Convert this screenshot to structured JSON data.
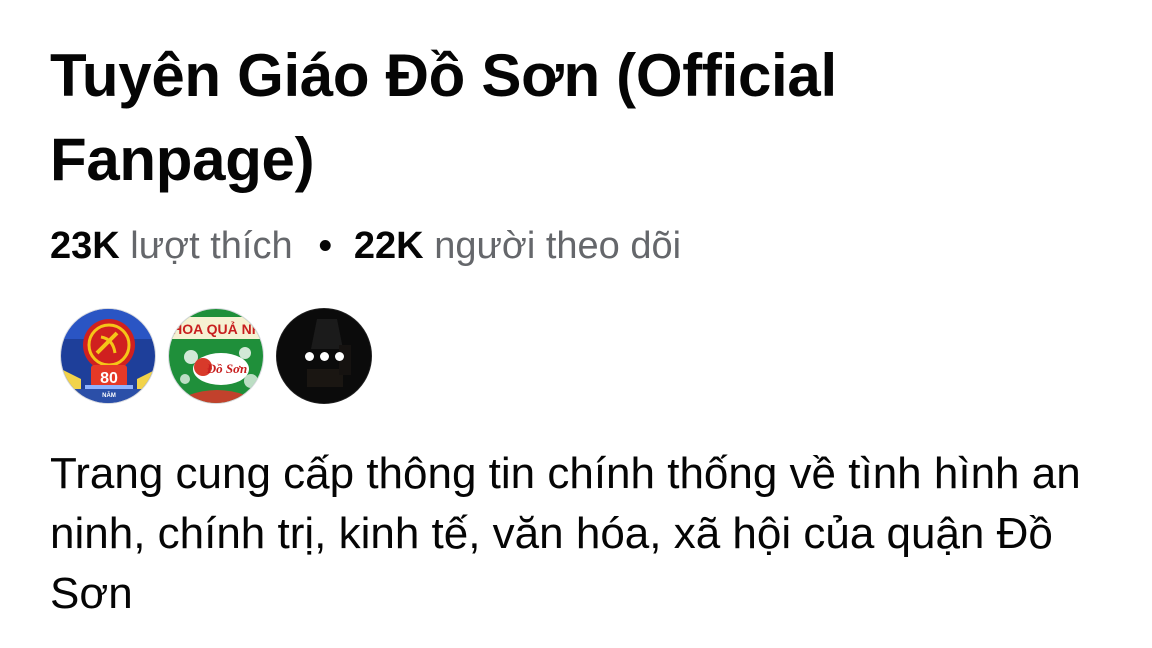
{
  "page": {
    "title": "Tuyên Giáo Đồ Sơn (Official Fanpage)",
    "likes_count": "23K",
    "likes_label": "lượt thích",
    "separator": "•",
    "followers_count": "22K",
    "followers_label": "người theo dõi",
    "description": "Trang cung cấp thông tin chính thống về tình hình an ninh, chính trị, kinh tế, văn hóa, xã hội của quận Đồ Sơn"
  },
  "mutual_followers": {
    "avatars": [
      {
        "name": "party-80-years-avatar",
        "text": "80",
        "subtext": "NĂM"
      },
      {
        "name": "hoa-qua-avatar",
        "text": "HOA QUẢ NH",
        "subtext": "Đồ Sơn"
      },
      {
        "name": "more-avatars",
        "icon": "ellipsis-icon"
      }
    ]
  },
  "colors": {
    "primary_text": "#050505",
    "secondary_text": "#65676b",
    "avatar1_bg": "#1e3f9a",
    "avatar1_red": "#d0201f",
    "avatar2_green": "#1f8f3a",
    "avatar2_red": "#c81e1e"
  }
}
